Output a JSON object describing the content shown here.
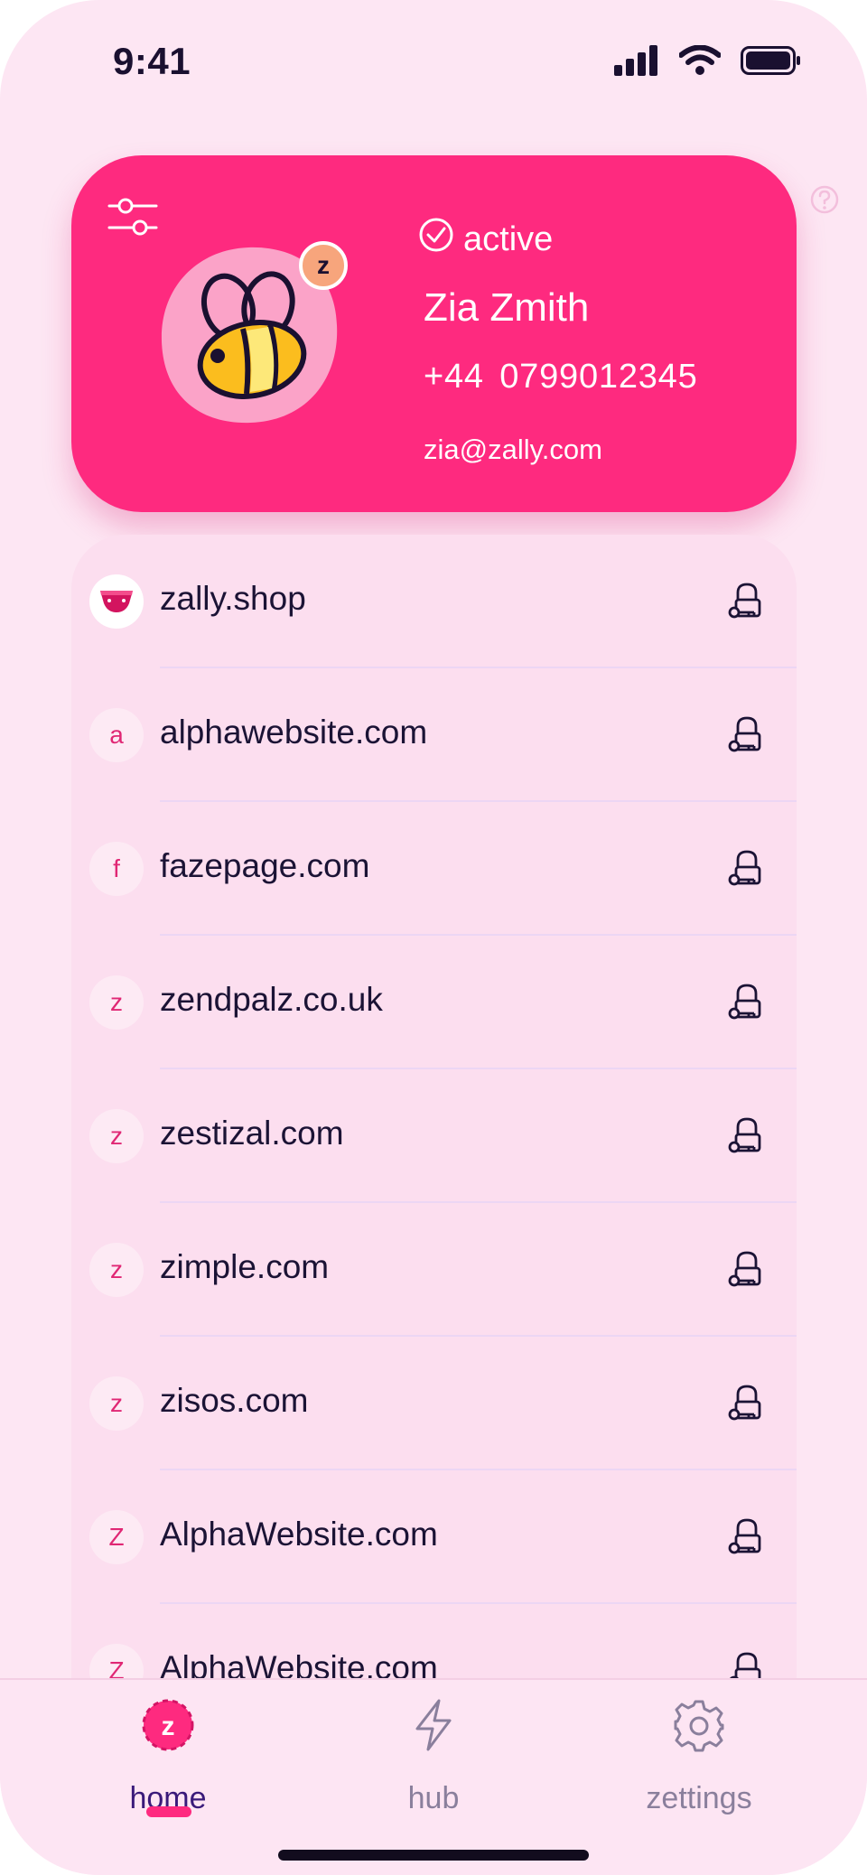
{
  "status_bar": {
    "time": "9:41",
    "icons": [
      "signal-icon",
      "wifi-icon",
      "battery-icon"
    ]
  },
  "profile": {
    "status": "active",
    "name": "Zia Zmith",
    "phone": "+44 0799012345",
    "email": "zia@zally.com",
    "badge": "z",
    "icons": [
      "filter-icon",
      "bee-avatar",
      "check-circle-icon",
      "help-icon"
    ]
  },
  "sites": [
    {
      "initial": "",
      "label": "zally.shop",
      "icon": "shop-logo"
    },
    {
      "initial": "a",
      "label": "alphawebsite.com",
      "icon": "lock-key-icon"
    },
    {
      "initial": "f",
      "label": "fazepage.com",
      "icon": "lock-key-icon"
    },
    {
      "initial": "z",
      "label": "zendpalz.co.uk",
      "icon": "lock-key-icon"
    },
    {
      "initial": "z",
      "label": "zestizal.com",
      "icon": "lock-key-icon"
    },
    {
      "initial": "z",
      "label": "zimple.com",
      "icon": "lock-key-icon"
    },
    {
      "initial": "z",
      "label": "zisos.com",
      "icon": "lock-key-icon"
    },
    {
      "initial": "Z",
      "label": "AlphaWebsite.com",
      "icon": "lock-key-icon"
    },
    {
      "initial": "Z",
      "label": "AlphaWebsite.com",
      "icon": "lock-key-icon"
    }
  ],
  "nav": {
    "home": {
      "label": "home",
      "icon": "z-logo-icon",
      "active": true
    },
    "hub": {
      "label": "hub",
      "icon": "lightning-icon",
      "active": false
    },
    "settings": {
      "label": "zettings",
      "icon": "gear-icon",
      "active": false
    }
  },
  "colors": {
    "brand": "#fe2a7f",
    "background": "#fde6f3",
    "text": "#1b1335",
    "nav_active": "#3a1a7a",
    "nav_inactive": "#8a7f9c"
  }
}
